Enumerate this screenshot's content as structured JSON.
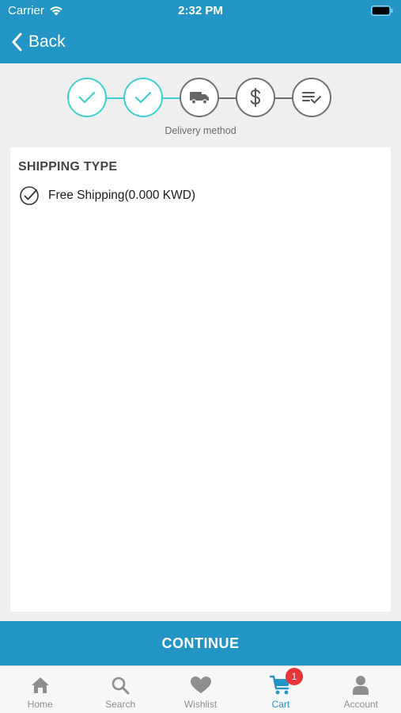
{
  "status_bar": {
    "carrier": "Carrier",
    "time": "2:32 PM"
  },
  "nav": {
    "back_label": "Back"
  },
  "checkout_steps": {
    "caption": "Delivery method",
    "steps": [
      {
        "icon": "check-icon",
        "state": "completed"
      },
      {
        "icon": "check-icon",
        "state": "completed"
      },
      {
        "icon": "truck-icon",
        "state": "current"
      },
      {
        "icon": "dollar-icon",
        "state": "pending"
      },
      {
        "icon": "list-check-icon",
        "state": "pending"
      }
    ]
  },
  "shipping": {
    "title": "SHIPPING TYPE",
    "options": [
      {
        "label": "Free Shipping(0.000 KWD)",
        "selected": true
      }
    ]
  },
  "continue_label": "CONTINUE",
  "tabbar": {
    "tabs": [
      {
        "label": "Home",
        "icon": "home-icon",
        "active": false
      },
      {
        "label": "Search",
        "icon": "search-icon",
        "active": false
      },
      {
        "label": "Wishlist",
        "icon": "heart-icon",
        "active": false
      },
      {
        "label": "Cart",
        "icon": "cart-icon",
        "active": true,
        "badge": "1"
      },
      {
        "label": "Account",
        "icon": "user-icon",
        "active": false
      }
    ]
  },
  "colors": {
    "primary": "#2395c5",
    "step_done": "#3dd0cf",
    "step_pending": "#707070",
    "badge": "#e8353a"
  }
}
